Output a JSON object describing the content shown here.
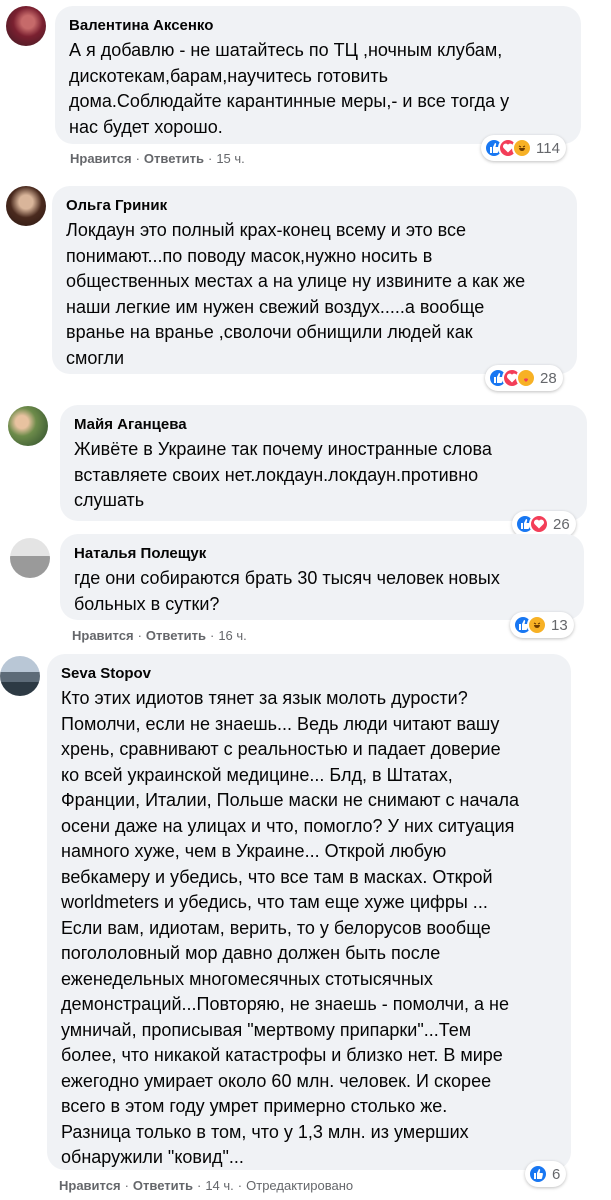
{
  "comments": [
    {
      "author": "Валентина Аксенко",
      "text": "А я добавлю - не шатайтесь по ТЦ ,ночным клубам,\nдискотекам,барам,научитесь готовить\nдома.Соблюдайте карантинные меры,- и все тогда у\nнас будет хорошо.",
      "like": "Нравится",
      "reply": "Ответить",
      "time": "15 ч.",
      "reactions": [
        "like",
        "love",
        "haha"
      ],
      "count": "114"
    },
    {
      "author": "Ольга Гриник",
      "text": "Локдаун это полный крах-конец всему и это все\nпонимают...по поводу масок,нужно носить в\nобщественных местах а на улице ну извините а как же\nнаши легкие им нужен свежий воздух.....а вообще\nвранье на вранье ,сволочи обнищили людей как\nсмогли",
      "reactions": [
        "like",
        "love",
        "care"
      ],
      "count": "28"
    },
    {
      "author": "Майя Аганцева",
      "text": "Живёте в Украине так почему иностранные слова\nвставляете своих нет.локдаун.локдаун.противно\nслушать",
      "reactions": [
        "like",
        "love"
      ],
      "count": "26"
    },
    {
      "author": "Наталья Полещук",
      "text": "где они собираются брать 30 тысяч человек новых\nбольных в сутки?",
      "like": "Нравится",
      "reply": "Ответить",
      "time": "16 ч.",
      "reactions": [
        "like",
        "haha"
      ],
      "count": "13"
    },
    {
      "author": "Seva Stopov",
      "text": "Кто этих идиотов тянет за язык молоть дурости?\nПомолчи, если не знаешь... Ведь люди читают вашу\nхрень, сравнивают с реальностью и падает доверие\nко всей украинской медицине... Блд, в Штатах,\nФранции, Италии, Польше маски не снимают с начала\nосени даже на улицах и что, помогло? У них ситуация\nнамного хуже, чем в Украине... Открой любую\nвебкамеру и убедись, что все там в масках. Открой\nworldmeters и убедись, что там еще хуже цифры ...\nЕсли вам, идиотам, верить, то у белорусов вообще\nпогололовный мор давно должен быть после\nеженедельных многомесячных стотысячных\nдемонстраций...Повторяю, не знаешь - помолчи, а не\nумничай, прописывая \"мертвому припарки\"...Тем\nболее, что никакой катастрофы и близко нет. В мире\nежегодно умирает около 60 млн. человек. И скорее\nвсего в этом году умрет примерно столько же.\nРазница только в том, что у 1,3 млн. из умерших\nобнаружили \"ковид\"...",
      "like": "Нравится",
      "reply": "Ответить",
      "time": "14 ч.",
      "edited": "Отредактировано",
      "reactions": [
        "like"
      ],
      "count": "6"
    }
  ],
  "colors": {
    "bubble": "#f0f2f5",
    "meta": "#65676b",
    "like": "#1877f2",
    "love": "#f33e58",
    "haha": "#f7b125"
  }
}
